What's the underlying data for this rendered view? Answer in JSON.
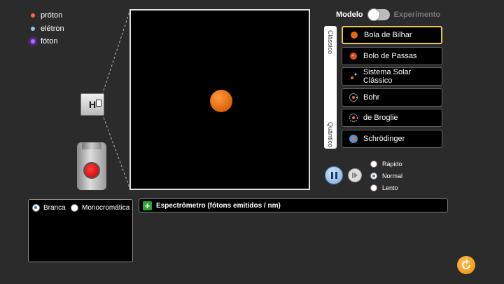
{
  "legend": {
    "items": [
      {
        "label": "próton",
        "color": "#f26b3a"
      },
      {
        "label": "elétron",
        "color": "#8fc6f0"
      },
      {
        "label": "fóton",
        "color": "#b266ff"
      }
    ]
  },
  "source": {
    "element_symbol": "H",
    "gun_icon": "light-gun-icon"
  },
  "toggle": {
    "left_label": "Modelo",
    "right_label": "Experimento",
    "state": "Modelo"
  },
  "tabs": {
    "top": "Clássico",
    "bottom": "Quântico"
  },
  "models": {
    "selected": "Bola de Bilhar",
    "items": [
      {
        "label": "Bola de Bilhar",
        "icon": "billiard-ball-icon"
      },
      {
        "label": "Bolo de Passas",
        "icon": "plum-pudding-icon"
      },
      {
        "label": "Sistema Solar Clássico",
        "icon": "solar-system-icon"
      },
      {
        "label": "Bohr",
        "icon": "bohr-atom-icon"
      },
      {
        "label": "de Broglie",
        "icon": "de-broglie-icon"
      },
      {
        "label": "Schrödinger",
        "icon": "schrodinger-cloud-icon"
      }
    ]
  },
  "speed": {
    "options": [
      "Rápido",
      "Normal",
      "Lento"
    ],
    "selected": "Normal"
  },
  "light": {
    "options": [
      "Branca",
      "Monocromática"
    ],
    "selected": "Branca"
  },
  "spectrometer": {
    "title": "Espectrômetro (fótons emitidos / nm)"
  },
  "colors": {
    "accent": "#e8c84a",
    "background": "#2b2b2b",
    "atom": "#e06a10"
  }
}
